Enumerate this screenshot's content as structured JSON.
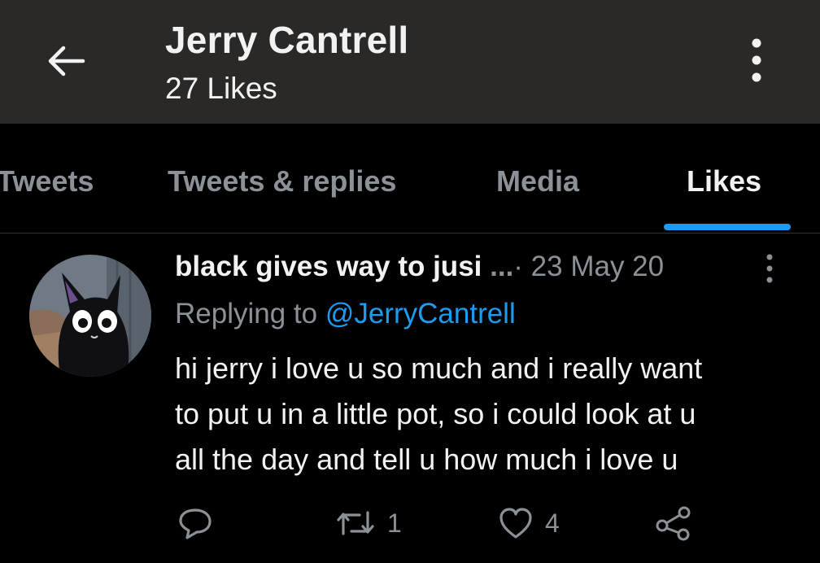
{
  "header": {
    "title": "Jerry Cantrell",
    "subtitle": "27 Likes",
    "back_icon": "arrow-left-icon",
    "more_icon": "more-vertical-icon"
  },
  "tabs": [
    {
      "label": "Tweets"
    },
    {
      "label": "Tweets & replies"
    },
    {
      "label": "Media"
    },
    {
      "label": "Likes",
      "active": true
    }
  ],
  "tweet": {
    "display_name": "black gives way to jusi",
    "ellipsis": " ...",
    "date": "· 23 May 20",
    "replying_prefix": "Replying to ",
    "replying_handle": "@JerryCantrell",
    "text_lines": [
      "hi jerry i love u so much and i really want",
      "to put u in a little pot, so i could look at u",
      "all the day and tell u how much i love u"
    ],
    "actions": {
      "retweet_count": "1",
      "like_count": "4"
    }
  },
  "colors": {
    "header_bg": "#2a2927",
    "accent": "#1d9bf0",
    "muted": "#8b9197",
    "text": "#f2f2f2"
  }
}
